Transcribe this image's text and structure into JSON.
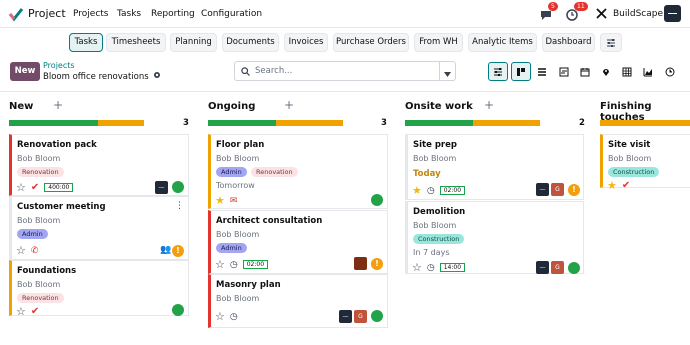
{
  "topbar": {
    "app_name": "Project",
    "menu": [
      "Projects",
      "Tasks",
      "Reporting",
      "Configuration"
    ],
    "chat_badge": "5",
    "activity_badge": "11",
    "company": "BuildScape"
  },
  "subnav": {
    "tabs": [
      "Tasks",
      "Timesheets",
      "Planning",
      "Documents",
      "Invoices",
      "Purchase Orders",
      "From WH",
      "Analytic Items",
      "Dashboard"
    ],
    "active_tab": "Tasks"
  },
  "controls": {
    "new_label": "New",
    "breadcrumb_parent": "Projects",
    "breadcrumb_current": "Bloom office renovations",
    "search_placeholder": "Search..."
  },
  "colors": {
    "green": "#22a34a",
    "orange": "#f0a300",
    "red": "#e3342f",
    "accent": "#017e84",
    "brand": "#714b67"
  },
  "columns": [
    {
      "title": "New",
      "count": "3",
      "progress_green": 0.66,
      "progress_orange": 0.34,
      "cards": [
        {
          "title": "Renovation pack",
          "assignee": "Bob Bloom",
          "tag": "Renovation",
          "time": "400:00"
        },
        {
          "title": "Customer meeting",
          "assignee": "Bob Bloom",
          "tag": "Admin"
        },
        {
          "title": "Foundations",
          "assignee": "Bob Bloom",
          "tag": "Renovation"
        }
      ]
    },
    {
      "title": "Ongoing",
      "count": "3",
      "progress_green": 0.5,
      "progress_orange": 0.5,
      "cards": [
        {
          "title": "Floor plan",
          "assignee": "Bob Bloom",
          "tags": [
            "Admin",
            "Renovation"
          ],
          "date": "Tomorrow"
        },
        {
          "title": "Architect consultation",
          "assignee": "Bob Bloom",
          "tag": "Admin",
          "time": "02:00"
        },
        {
          "title": "Masonry plan",
          "assignee": "Bob Bloom",
          "avatar": "G"
        }
      ]
    },
    {
      "title": "Onsite work",
      "count": "2",
      "progress_green": 0.5,
      "progress_orange": 0.5,
      "cards": [
        {
          "title": "Site prep",
          "assignee": "Bob Bloom",
          "date": "Today",
          "time": "02:00",
          "avatar": "G"
        },
        {
          "title": "Demolition",
          "assignee": "Bob Bloom",
          "tag": "Construction",
          "date": "In 7 days",
          "time": "14:00"
        }
      ]
    },
    {
      "title": "Finishing touches",
      "count": "",
      "cards": [
        {
          "title": "Site visit",
          "assignee": "Bob Bloom",
          "tag": "Construction"
        }
      ]
    }
  ]
}
